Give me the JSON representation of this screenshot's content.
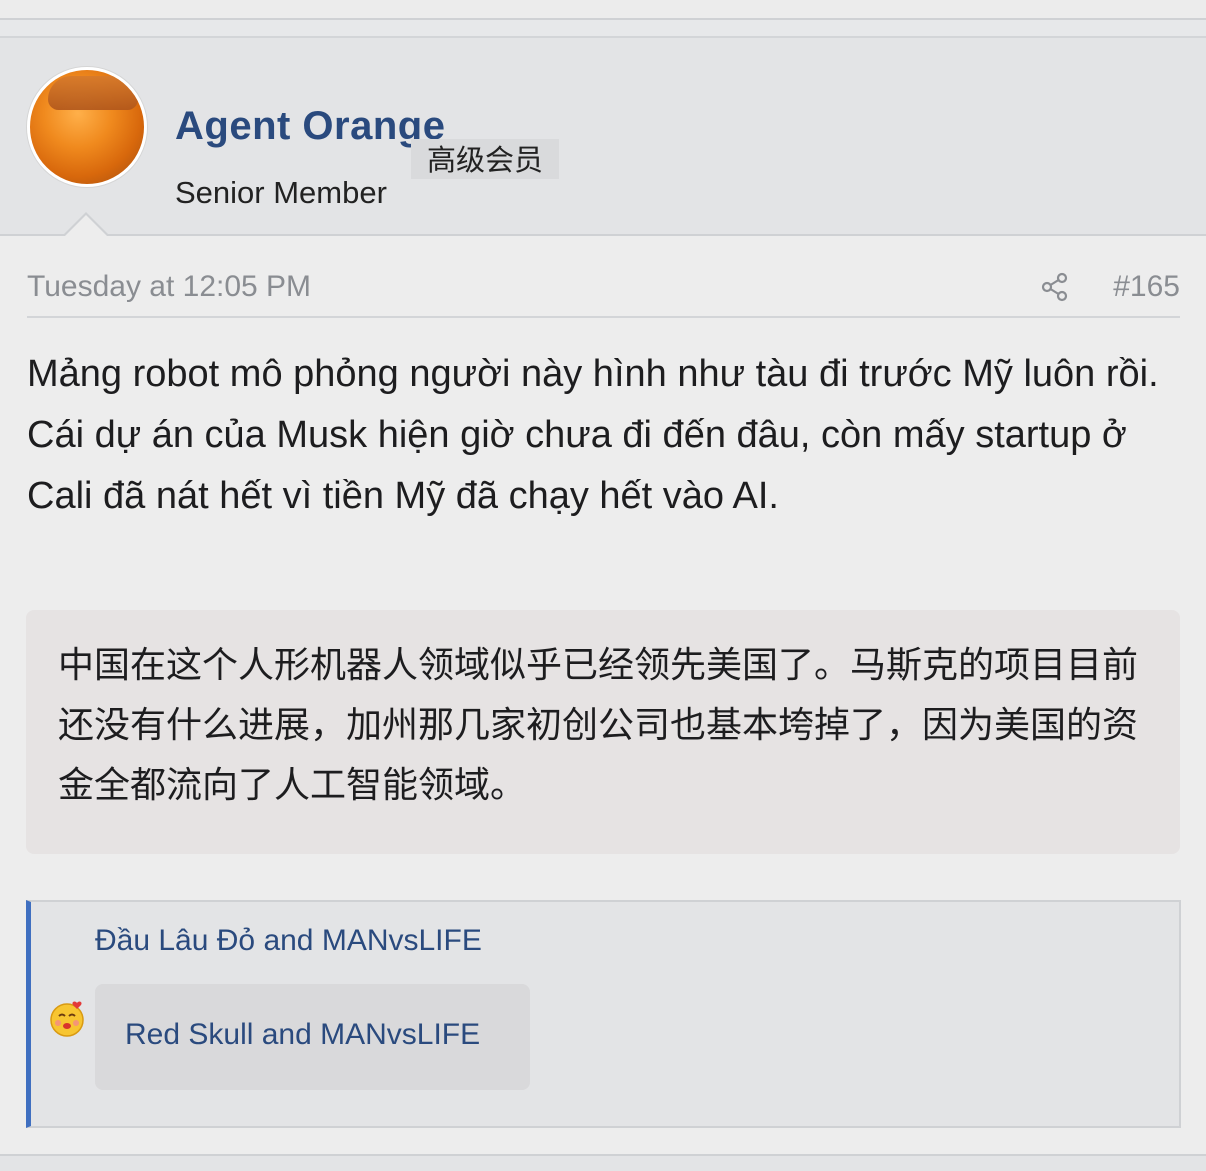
{
  "user": {
    "name": "Agent Orange",
    "title": "Senior Member",
    "title_translation": "高级会员",
    "avatar_icon": "orange-avatar-icon"
  },
  "post": {
    "date": "Tuesday at 12:05 PM",
    "number": "#165",
    "share_icon": "share-icon",
    "body": "Mảng robot mô phỏng người này hình như tàu đi trước Mỹ luôn rồi. Cái dự án của Musk hiện giờ chưa đi đến đâu, còn mấy startup ở Cali đã nát hết vì tiền Mỹ đã chạy hết vào AI.",
    "translation": "中国在这个人形机器人领域似乎已经领先美国了。马斯克的项目目前还没有什么进展，加州那几家初创公司也基本垮掉了，因为美国的资金全都流向了人工智能领域。"
  },
  "reactions": {
    "reactors": "Đầu Lâu Đỏ and MANvsLIFE",
    "reactors_translated": "Red Skull and MANvsLIFE",
    "emoji_icon": "kiss-emoji-icon"
  },
  "colors": {
    "link": "#2a4a7e",
    "accent_border": "#3f6fc0",
    "meta_text": "#8a8d92"
  }
}
